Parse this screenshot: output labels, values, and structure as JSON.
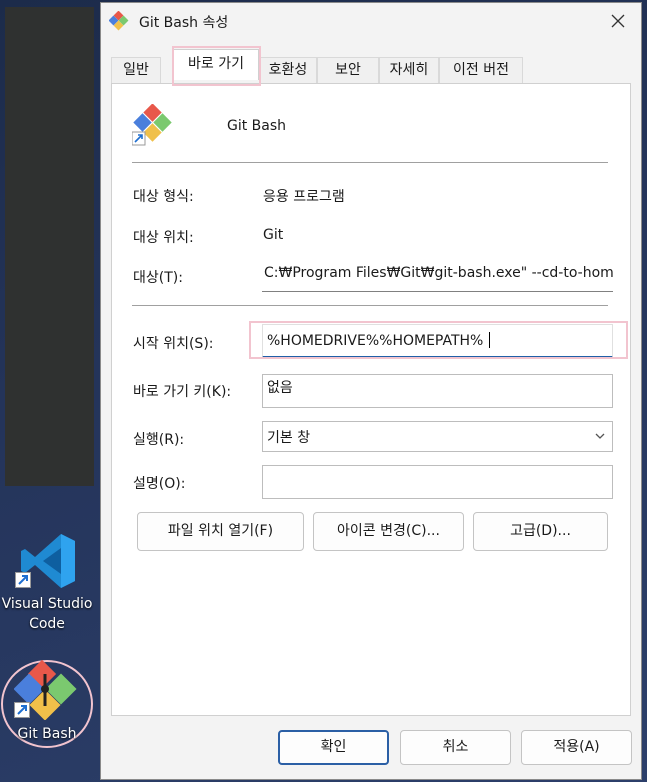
{
  "desktop": {
    "icons": [
      {
        "label_line1": "Visual Studio",
        "label_line2": "Code"
      },
      {
        "label": "Git Bash"
      }
    ]
  },
  "dialog": {
    "title": "Git Bash 속성",
    "tabs": [
      "일반",
      "바로 가기",
      "호환성",
      "보안",
      "자세히",
      "이전 버전"
    ],
    "active_tab": "바로 가기",
    "app_name": "Git Bash",
    "target_type_label": "대상 형식:",
    "target_type_value": "응용 프로그램",
    "target_location_label": "대상 위치:",
    "target_location_value": "Git",
    "target_label": "대상(T):",
    "target_value": "C:₩Program Files₩Git₩git-bash.exe\" --cd-to-home",
    "start_in_label": "시작 위치(S):",
    "start_in_value": "%HOMEDRIVE%%HOMEPATH%",
    "shortcut_key_label": "바로 가기 키(K):",
    "shortcut_key_value": "없음",
    "run_label": "실행(R):",
    "run_value": "기본 창",
    "comment_label": "설명(O):",
    "comment_value": "",
    "open_location_button": "파일 위치 열기(F)",
    "change_icon_button": "아이콘 변경(C)...",
    "advanced_button": "고급(D)...",
    "ok_button": "확인",
    "cancel_button": "취소",
    "apply_button": "적용(A)",
    "colors": {
      "accent": "#1f5fa8",
      "highlight": "#f2c4cf"
    }
  }
}
